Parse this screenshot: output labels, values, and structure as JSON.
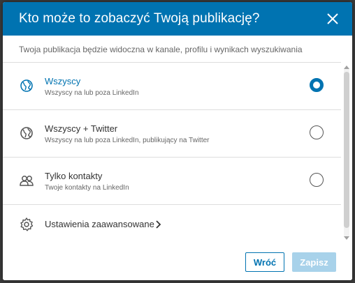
{
  "dialog": {
    "title": "Kto może to zobaczyć Twoją publikację?",
    "subtitle": "Twoja publikacja będzie widoczna w kanale, profilu i wynikach wyszukiwania",
    "close_icon": "close-icon"
  },
  "options": [
    {
      "label": "Wszyscy",
      "desc": "Wszyscy na lub poza LinkedIn",
      "icon": "globe-icon",
      "selected": true
    },
    {
      "label": "Wszyscy + Twitter",
      "desc": "Wszyscy na lub poza LinkedIn, publikujący na Twitter",
      "icon": "globe-icon",
      "selected": false
    },
    {
      "label": "Tylko kontakty",
      "desc": "Twoje kontakty na LinkedIn",
      "icon": "people-icon",
      "selected": false
    }
  ],
  "advanced": {
    "label": "Ustawienia zaawansowane",
    "icon": "gear-icon"
  },
  "footer": {
    "back_label": "Wróć",
    "save_label": "Zapisz"
  },
  "colors": {
    "brand": "#0073b1",
    "disabled": "#a8d2ea"
  }
}
